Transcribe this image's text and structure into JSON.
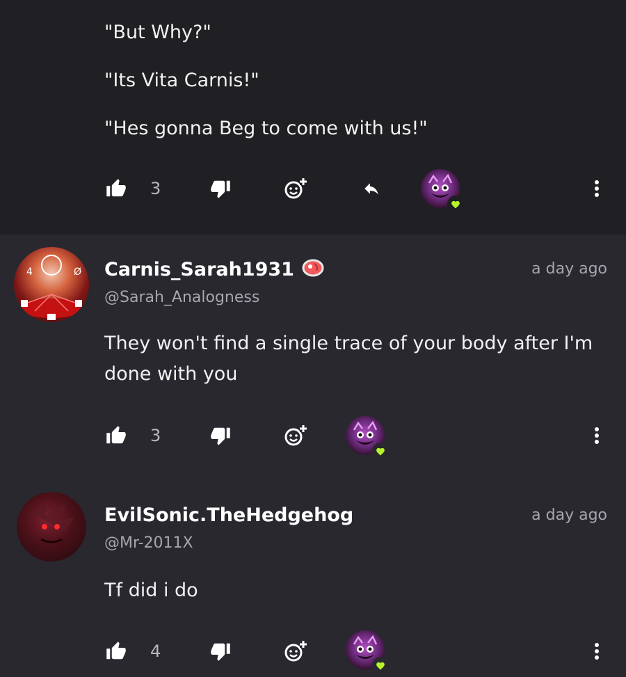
{
  "top_comment": {
    "lines": [
      "\"But Why?\"",
      "\"Its Vita Carnis!\"",
      "\"Hes gonna Beg to come with us!\""
    ],
    "likes": "3"
  },
  "comments": [
    {
      "username": "Carnis_Sarah1931",
      "username_emoji": "meat-emoji",
      "handle": "@Sarah_Analogness",
      "time": "a day ago",
      "text": "They won't find a single trace of your body after I'm done with you",
      "likes": "3"
    },
    {
      "username": "EvilSonic.TheHedgehog",
      "handle": "@Mr-2011X",
      "time": "a day ago",
      "text": "Tf did i do",
      "likes": "4"
    }
  ],
  "colors": {
    "background": "#29282f",
    "top_background": "#201f24",
    "heart_badge": "#b6f22b",
    "muted_text": "#a7a6ad"
  }
}
